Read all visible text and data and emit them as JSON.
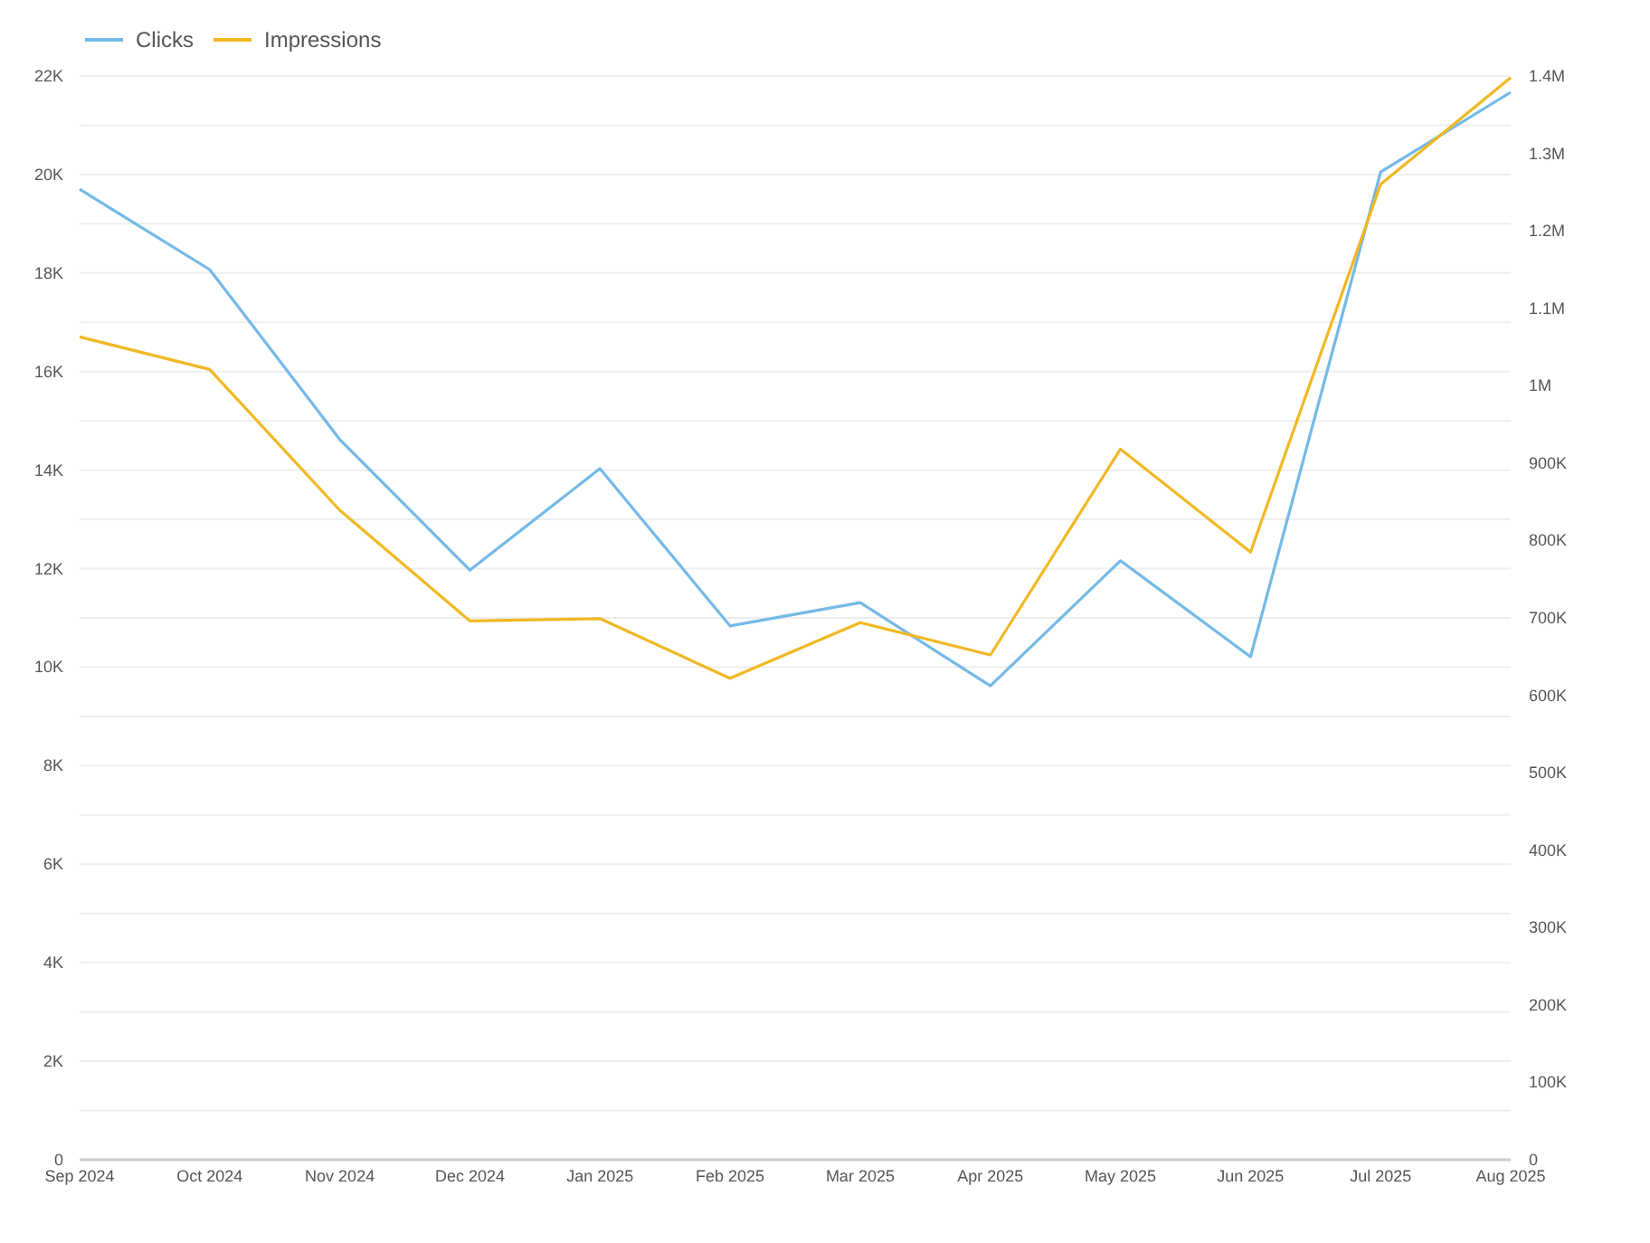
{
  "chart_data": {
    "type": "line",
    "grid": true,
    "legend": "top-left",
    "categories": [
      "Sep 2024",
      "Oct 2024",
      "Nov 2024",
      "Dec 2024",
      "Jan 2025",
      "Feb 2025",
      "Mar 2025",
      "Apr 2025",
      "May 2025",
      "Jun 2025",
      "Jul 2025",
      "Aug 2025"
    ],
    "series": [
      {
        "name": "Clicks",
        "color": "#74b9e7",
        "values": [
          19700,
          18070,
          14620,
          11970,
          14030,
          10840,
          11310,
          9620,
          12160,
          10210,
          20050,
          21670
        ]
      },
      {
        "name": "Impressions",
        "color": "#f0b823",
        "axis": "y2",
        "values": [
          1063000,
          1021000,
          839000,
          696000,
          699000,
          622000,
          694000,
          652000,
          918000,
          785000,
          1260000,
          1398000
        ]
      }
    ],
    "ylim": [
      0,
      22000
    ],
    "yticks": [
      {
        "value": 0,
        "label": "0"
      },
      {
        "value": 2000,
        "label": "2K"
      },
      {
        "value": 4000,
        "label": "4K"
      },
      {
        "value": 6000,
        "label": "6K"
      },
      {
        "value": 8000,
        "label": "8K"
      },
      {
        "value": 10000,
        "label": "10K"
      },
      {
        "value": 12000,
        "label": "12K"
      },
      {
        "value": 14000,
        "label": "14K"
      },
      {
        "value": 16000,
        "label": "16K"
      },
      {
        "value": 18000,
        "label": "18K"
      },
      {
        "value": 20000,
        "label": "20K"
      },
      {
        "value": 22000,
        "label": "22K"
      }
    ],
    "y2lim": [
      0,
      1400000
    ],
    "y2ticks": [
      {
        "value": 0,
        "label": "0"
      },
      {
        "value": 100000,
        "label": "100K"
      },
      {
        "value": 200000,
        "label": "200K"
      },
      {
        "value": 300000,
        "label": "300K"
      },
      {
        "value": 400000,
        "label": "400K"
      },
      {
        "value": 500000,
        "label": "500K"
      },
      {
        "value": 600000,
        "label": "600K"
      },
      {
        "value": 700000,
        "label": "700K"
      },
      {
        "value": 800000,
        "label": "800K"
      },
      {
        "value": 900000,
        "label": "900K"
      },
      {
        "value": 1000000,
        "label": "1M"
      },
      {
        "value": 1100000,
        "label": "1.1M"
      },
      {
        "value": 1200000,
        "label": "1.2M"
      },
      {
        "value": 1300000,
        "label": "1.3M"
      },
      {
        "value": 1400000,
        "label": "1.4M"
      }
    ]
  }
}
